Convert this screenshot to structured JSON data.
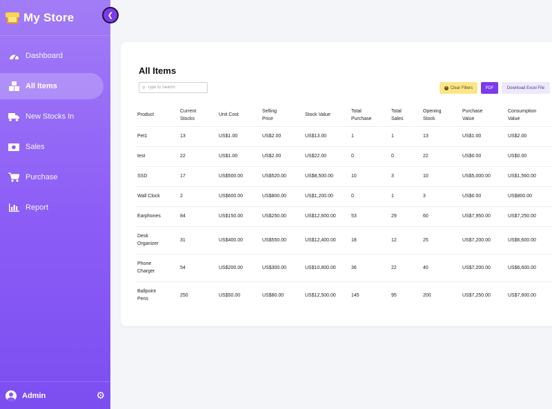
{
  "sidebar": {
    "brand": "My Store",
    "items": [
      {
        "label": "Dashboard",
        "icon": "dashboard-gauge-icon"
      },
      {
        "label": "All Items",
        "icon": "boxes-icon",
        "active": true
      },
      {
        "label": "New Stocks In",
        "icon": "truck-icon"
      },
      {
        "label": "Sales",
        "icon": "money-icon"
      },
      {
        "label": "Purchase",
        "icon": "cart-icon"
      },
      {
        "label": "Report",
        "icon": "bar-chart-icon"
      }
    ],
    "footer": {
      "user": "Admin"
    }
  },
  "main": {
    "title": "All Items",
    "search_placeholder": "Type to Search",
    "buttons": {
      "clear": "Clear Filters",
      "pdf": "PDF",
      "excel": "Download Excel File"
    },
    "table": {
      "headers": [
        [
          "Product"
        ],
        [
          "Current",
          "Stocks"
        ],
        [
          "Unit Cost"
        ],
        [
          "Selling",
          "Price"
        ],
        [
          "Stock Value"
        ],
        [
          "Total",
          "Purchase"
        ],
        [
          "Total",
          "Sales"
        ],
        [
          "Opening",
          "Stock"
        ],
        [
          "Purchase",
          "Value"
        ],
        [
          "Consumption",
          "Value"
        ]
      ],
      "rows": [
        [
          [
            "Pet1"
          ],
          "13",
          "US$1.00",
          "US$2.00",
          "US$13.00",
          "1",
          "1",
          "13",
          "US$1.00",
          "US$2.00"
        ],
        [
          [
            "test"
          ],
          "22",
          "US$1.00",
          "US$2.00",
          "US$22.00",
          "0",
          "0",
          "22",
          "US$0.00",
          "US$0.00"
        ],
        [
          [
            "SSD"
          ],
          "17",
          "US$500.00",
          "US$520.00",
          "US$8,500.00",
          "10",
          "3",
          "10",
          "US$5,000.00",
          "US$1,560.00"
        ],
        [
          [
            "Wall Clock"
          ],
          "2",
          "US$600.00",
          "US$800.00",
          "US$1,200.00",
          "0",
          "1",
          "3",
          "US$0.00",
          "US$800.00"
        ],
        [
          [
            "Earphones"
          ],
          "84",
          "US$150.00",
          "US$250.00",
          "US$12,600.00",
          "53",
          "29",
          "60",
          "US$7,950.00",
          "US$7,250.00"
        ],
        [
          [
            "Desk",
            "Organizer"
          ],
          "31",
          "US$400.00",
          "US$550.00",
          "US$12,400.00",
          "18",
          "12",
          "25",
          "US$7,200.00",
          "US$6,600.00"
        ],
        [
          [
            "Phone",
            "Charger"
          ],
          "54",
          "US$200.00",
          "US$300.00",
          "US$10,800.00",
          "36",
          "22",
          "40",
          "US$7,200.00",
          "US$6,600.00"
        ],
        [
          [
            "Ballpoint",
            "Pens"
          ],
          "250",
          "US$50.00",
          "US$80.00",
          "US$12,500.00",
          "145",
          "95",
          "200",
          "US$7,250.00",
          "US$7,600.00"
        ]
      ]
    }
  }
}
